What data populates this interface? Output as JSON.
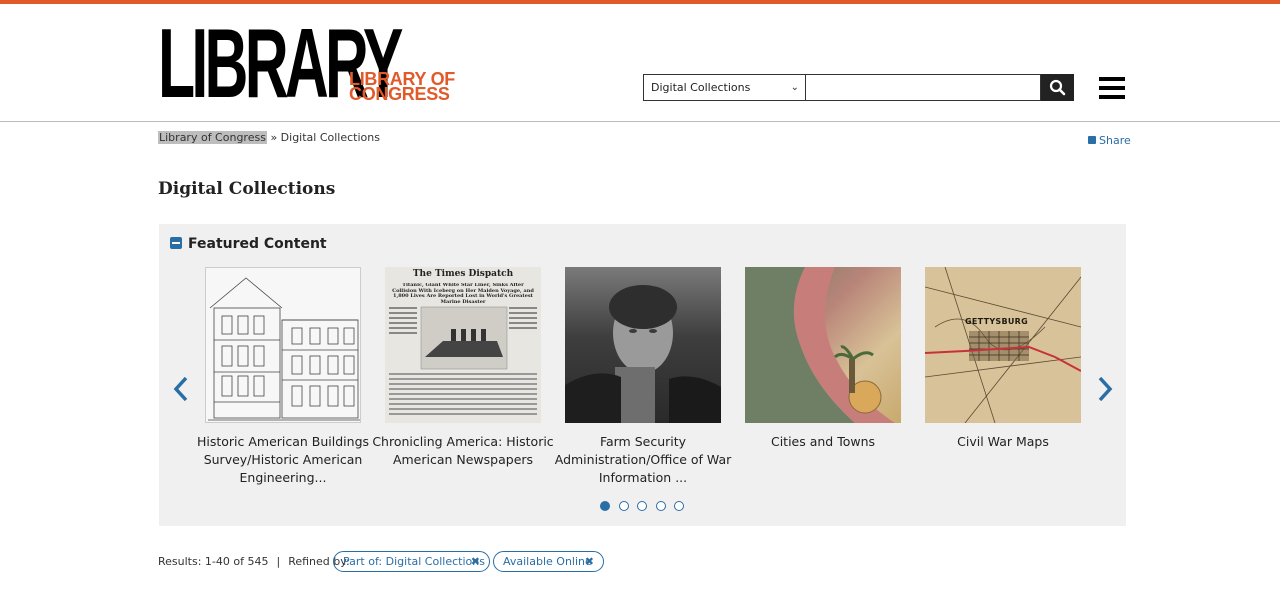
{
  "header": {
    "logo_main": "LIBRARY",
    "logo_sub": "LIBRARY OF CONGRESS",
    "search_scope": "Digital Collections",
    "search_value": ""
  },
  "breadcrumb": {
    "home": "Library of Congress",
    "separator": "»",
    "current": "Digital Collections"
  },
  "share_label": "Share",
  "page_title": "Digital Collections",
  "featured": {
    "title": "Featured Content",
    "cards": [
      {
        "caption": "Historic American Buildings Survey/Historic American Engineering..."
      },
      {
        "caption": "Chronicling America: Historic American Newspapers"
      },
      {
        "caption": "Farm Security Administration/Office of War Information ..."
      },
      {
        "caption": "Cities and Towns"
      },
      {
        "caption": "Civil War Maps"
      }
    ],
    "newspaper_masthead": "The Times Dispatch",
    "newspaper_headline": "Titanic, Giant White Star Liner, Sinks After Collision With Iceberg on Her Maiden Voyage, and 1,800 Lives Are Reported Lost in World's Greatest Marine Disaster",
    "map_label": "GETTYSBURG",
    "pages": 5,
    "active_page": 1
  },
  "results": {
    "summary": "Results: 1-40 of 545",
    "separator": "|",
    "refined_label": "Refined by:",
    "filters": [
      {
        "label": "Part of: Digital Collections"
      },
      {
        "label": "Available Online"
      }
    ]
  },
  "colors": {
    "accent": "#e05a2a",
    "link": "#2a6ea6",
    "panel": "#f0f0f0"
  }
}
